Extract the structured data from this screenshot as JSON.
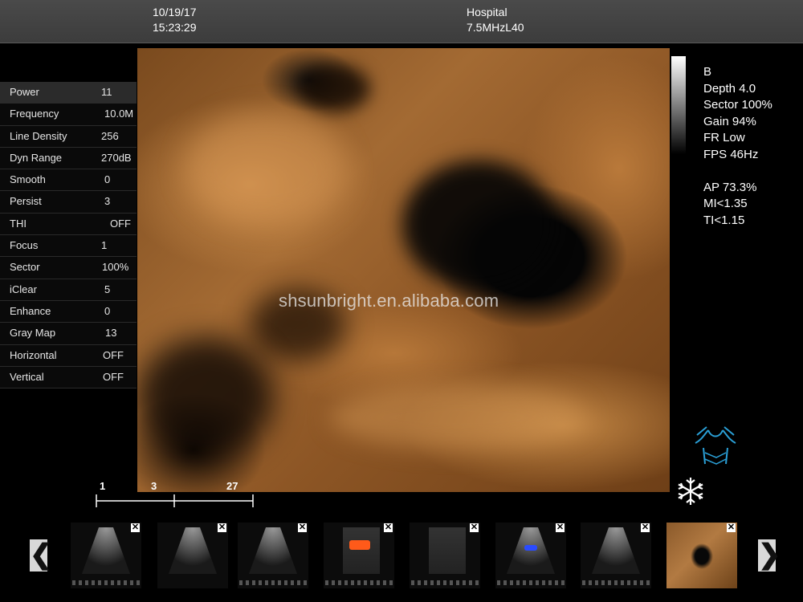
{
  "header": {
    "date": "10/19/17",
    "time": "15:23:29",
    "hospital": "Hospital",
    "probe": "7.5MHzL40"
  },
  "params": [
    {
      "label": "Power",
      "value": "11"
    },
    {
      "label": "Frequency",
      "value": "10.0M"
    },
    {
      "label": "Line Density",
      "value": "256"
    },
    {
      "label": "Dyn Range",
      "value": "270dB"
    },
    {
      "label": "Smooth",
      "value": "0"
    },
    {
      "label": "Persist",
      "value": "3"
    },
    {
      "label": "THI",
      "value": "OFF"
    },
    {
      "label": "Focus",
      "value": "1"
    },
    {
      "label": "Sector",
      "value": "100%"
    },
    {
      "label": "iClear",
      "value": "5"
    },
    {
      "label": "Enhance",
      "value": "0"
    },
    {
      "label": "Gray Map",
      "value": "13"
    },
    {
      "label": "Horizontal",
      "value": "OFF"
    },
    {
      "label": "Vertical",
      "value": "OFF"
    }
  ],
  "info": {
    "mode": "B",
    "depth": "Depth 4.0",
    "sector": "Sector 100%",
    "gain": "Gain 94%",
    "fr": "FR Low",
    "fps": "FPS 46Hz",
    "ap": "AP 73.3%",
    "mi": "MI<1.35",
    "ti": "TI<1.15"
  },
  "watermark": "shsunbright.en.alibaba.com",
  "scale": {
    "marks": [
      "1",
      "3",
      "27"
    ]
  },
  "icons": {
    "body_mark": "body-mark-icon",
    "freeze": "freeze-snowflake-icon",
    "prev": "chevron-left-icon",
    "next": "chevron-right-icon",
    "close": "close-icon"
  },
  "nav": {
    "prev": "❮",
    "next": "❯"
  },
  "thumbnails": {
    "close_glyph": "✕"
  },
  "colors": {
    "accent": "#2a9fd6",
    "sepia": "#a36a33",
    "doppler_red": "#ff5a1a",
    "doppler_blue": "#2a4bff"
  }
}
